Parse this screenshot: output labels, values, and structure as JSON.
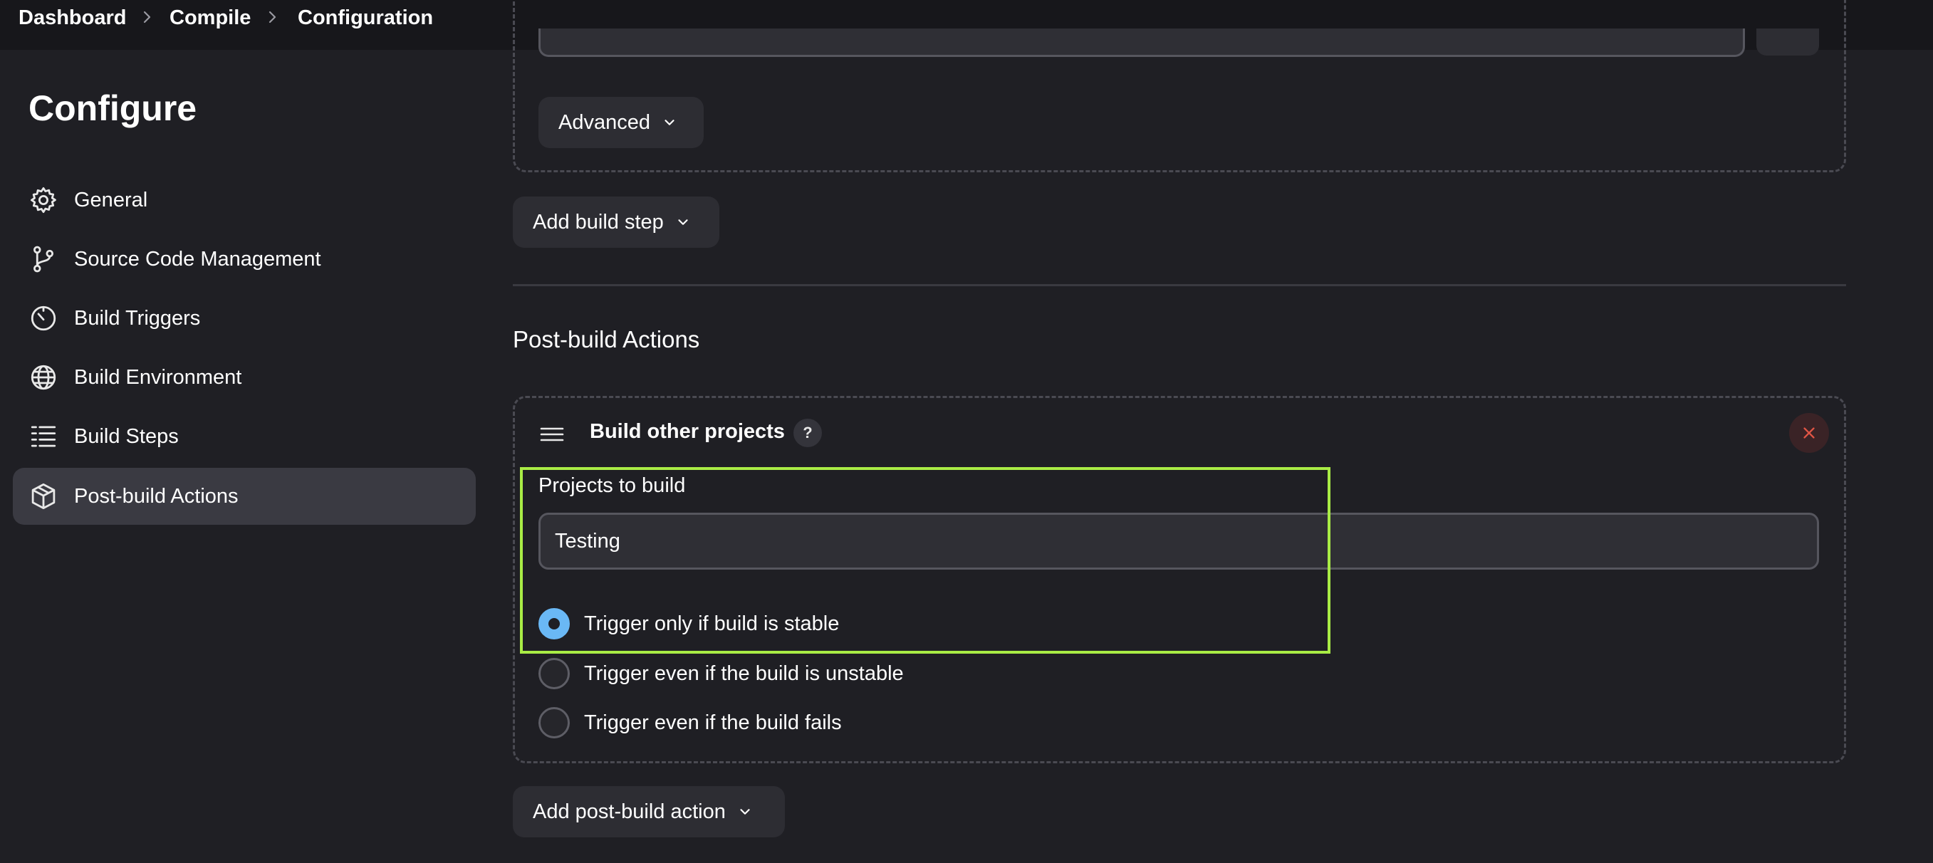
{
  "breadcrumb": {
    "items": [
      "Dashboard",
      "Compile",
      "Configuration"
    ]
  },
  "sidebar": {
    "title": "Configure",
    "items": [
      {
        "label": "General",
        "icon": "gear-icon"
      },
      {
        "label": "Source Code Management",
        "icon": "git-branch-icon"
      },
      {
        "label": "Build Triggers",
        "icon": "timer-icon"
      },
      {
        "label": "Build Environment",
        "icon": "globe-icon"
      },
      {
        "label": "Build Steps",
        "icon": "list-icon"
      },
      {
        "label": "Post-build Actions",
        "icon": "package-icon",
        "active": true
      }
    ]
  },
  "main": {
    "advanced_button": "Advanced",
    "add_build_step_button": "Add build step",
    "post_build_title": "Post-build Actions",
    "build_other": {
      "title": "Build other projects",
      "help": "?",
      "projects_label": "Projects to build",
      "projects_value": "Testing",
      "radio_options": [
        {
          "label": "Trigger only if build is stable",
          "checked": true
        },
        {
          "label": "Trigger even if the build is unstable",
          "checked": false
        },
        {
          "label": "Trigger even if the build fails",
          "checked": false
        }
      ]
    },
    "add_post_build_button": "Add post-build action"
  },
  "colors": {
    "background": "#1f1f24",
    "topbar": "#17171b",
    "active_item": "#3a3a42",
    "radio_checked": "#6ab8f5",
    "highlight": "#a9ec45",
    "close": "#e05545"
  }
}
